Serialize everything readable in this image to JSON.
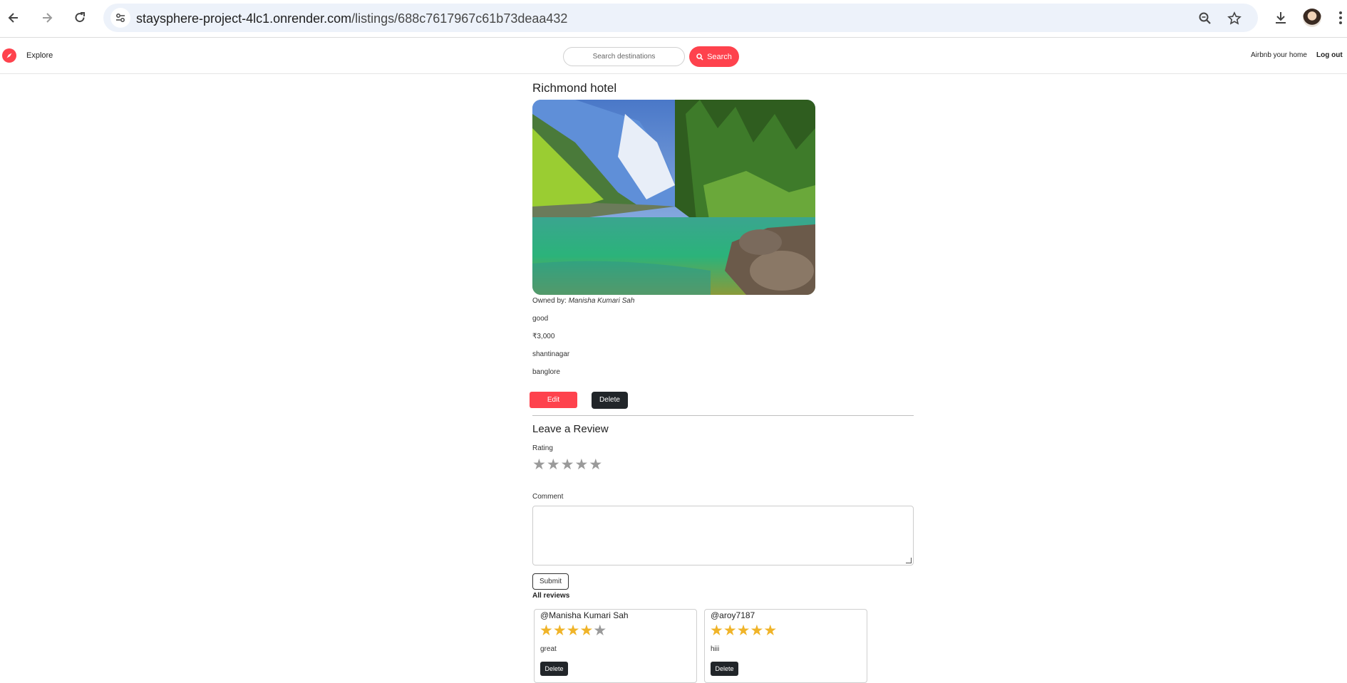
{
  "browser": {
    "url_host": "staysphere-project-4lc1.onrender.com",
    "url_path": "/listings/688c7617967c61b73deaa432",
    "icons": [
      "back-icon",
      "forward-icon",
      "reload-icon",
      "site-settings-icon",
      "zoom-icon",
      "bookmark-star-icon",
      "download-icon",
      "profile-avatar",
      "menu-kebab-icon"
    ]
  },
  "navbar": {
    "brand_icon": "compass-icon",
    "explore_label": "Explore",
    "search_placeholder": "Search destinations",
    "search_button_label": "Search",
    "host_link": "Airbnb your home",
    "logout_link": "Log out",
    "accent_color": "#fe424d"
  },
  "listing": {
    "title": "Richmond hotel",
    "owner_prefix": "Owned by: ",
    "owner_name": "Manisha Kumari Sah",
    "description": "good",
    "price": "₹3,000",
    "location": "shantinagar",
    "country": "banglore",
    "edit_label": "Edit",
    "delete_label": "Delete"
  },
  "review_form": {
    "heading": "Leave a Review",
    "rating_label": "Rating",
    "rating_max": 5,
    "rating_value": 0,
    "comment_label": "Comment",
    "comment_value": "",
    "submit_label": "Submit"
  },
  "reviews": {
    "heading": "All reviews",
    "items": [
      {
        "author": "@Manisha Kumari Sah",
        "rating": 4,
        "comment": "great",
        "delete_label": "Delete"
      },
      {
        "author": "@aroy7187",
        "rating": 5,
        "comment": "hiii",
        "delete_label": "Delete"
      }
    ]
  }
}
